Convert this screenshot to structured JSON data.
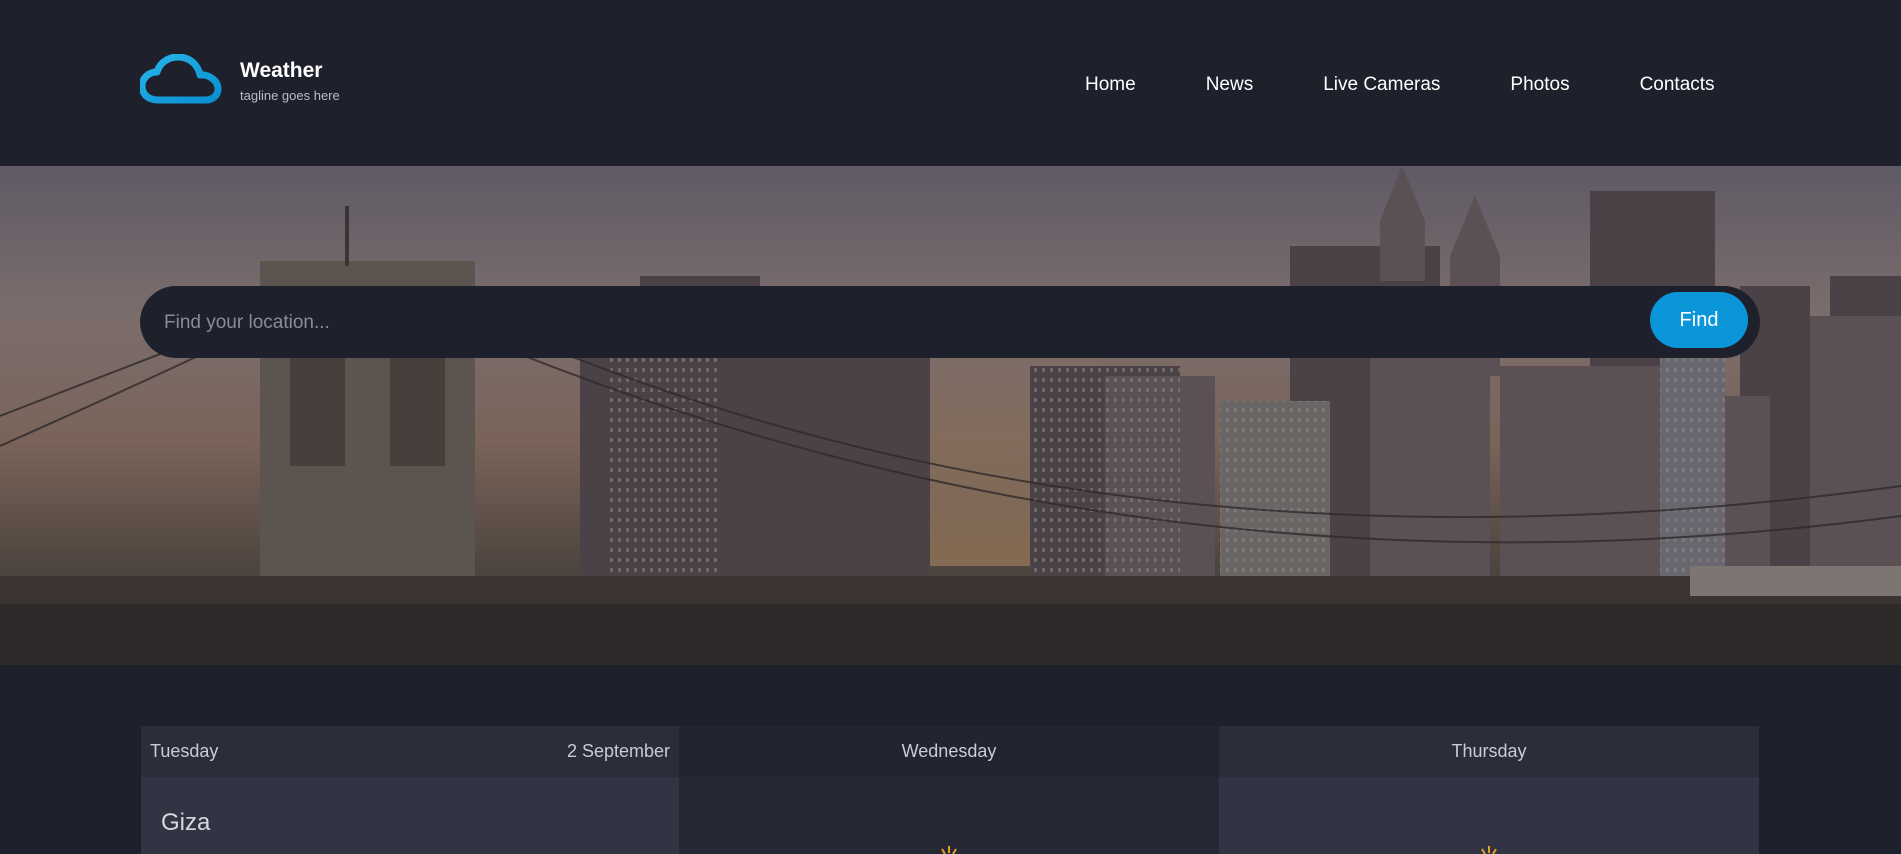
{
  "brand": {
    "name": "Weather",
    "tagline": "tagline goes here",
    "logo_icon": "cloud-icon",
    "accent": "#1aa7df"
  },
  "nav": {
    "items": [
      {
        "label": "Home"
      },
      {
        "label": "News"
      },
      {
        "label": "Live Cameras"
      },
      {
        "label": "Photos"
      },
      {
        "label": "Contacts"
      }
    ]
  },
  "search": {
    "placeholder": "Find your location...",
    "value": "",
    "button_label": "Find",
    "button_color": "#0a96d8"
  },
  "forecast": {
    "today": {
      "day": "Tuesday",
      "date": "2 September",
      "location": "Giza"
    },
    "days": [
      {
        "day": "Wednesday",
        "icon": "sun-icon"
      },
      {
        "day": "Thursday",
        "icon": "sun-icon"
      }
    ]
  },
  "colors": {
    "background": "#1e202b",
    "panel": "#323444",
    "panel_alt": "#262834"
  }
}
